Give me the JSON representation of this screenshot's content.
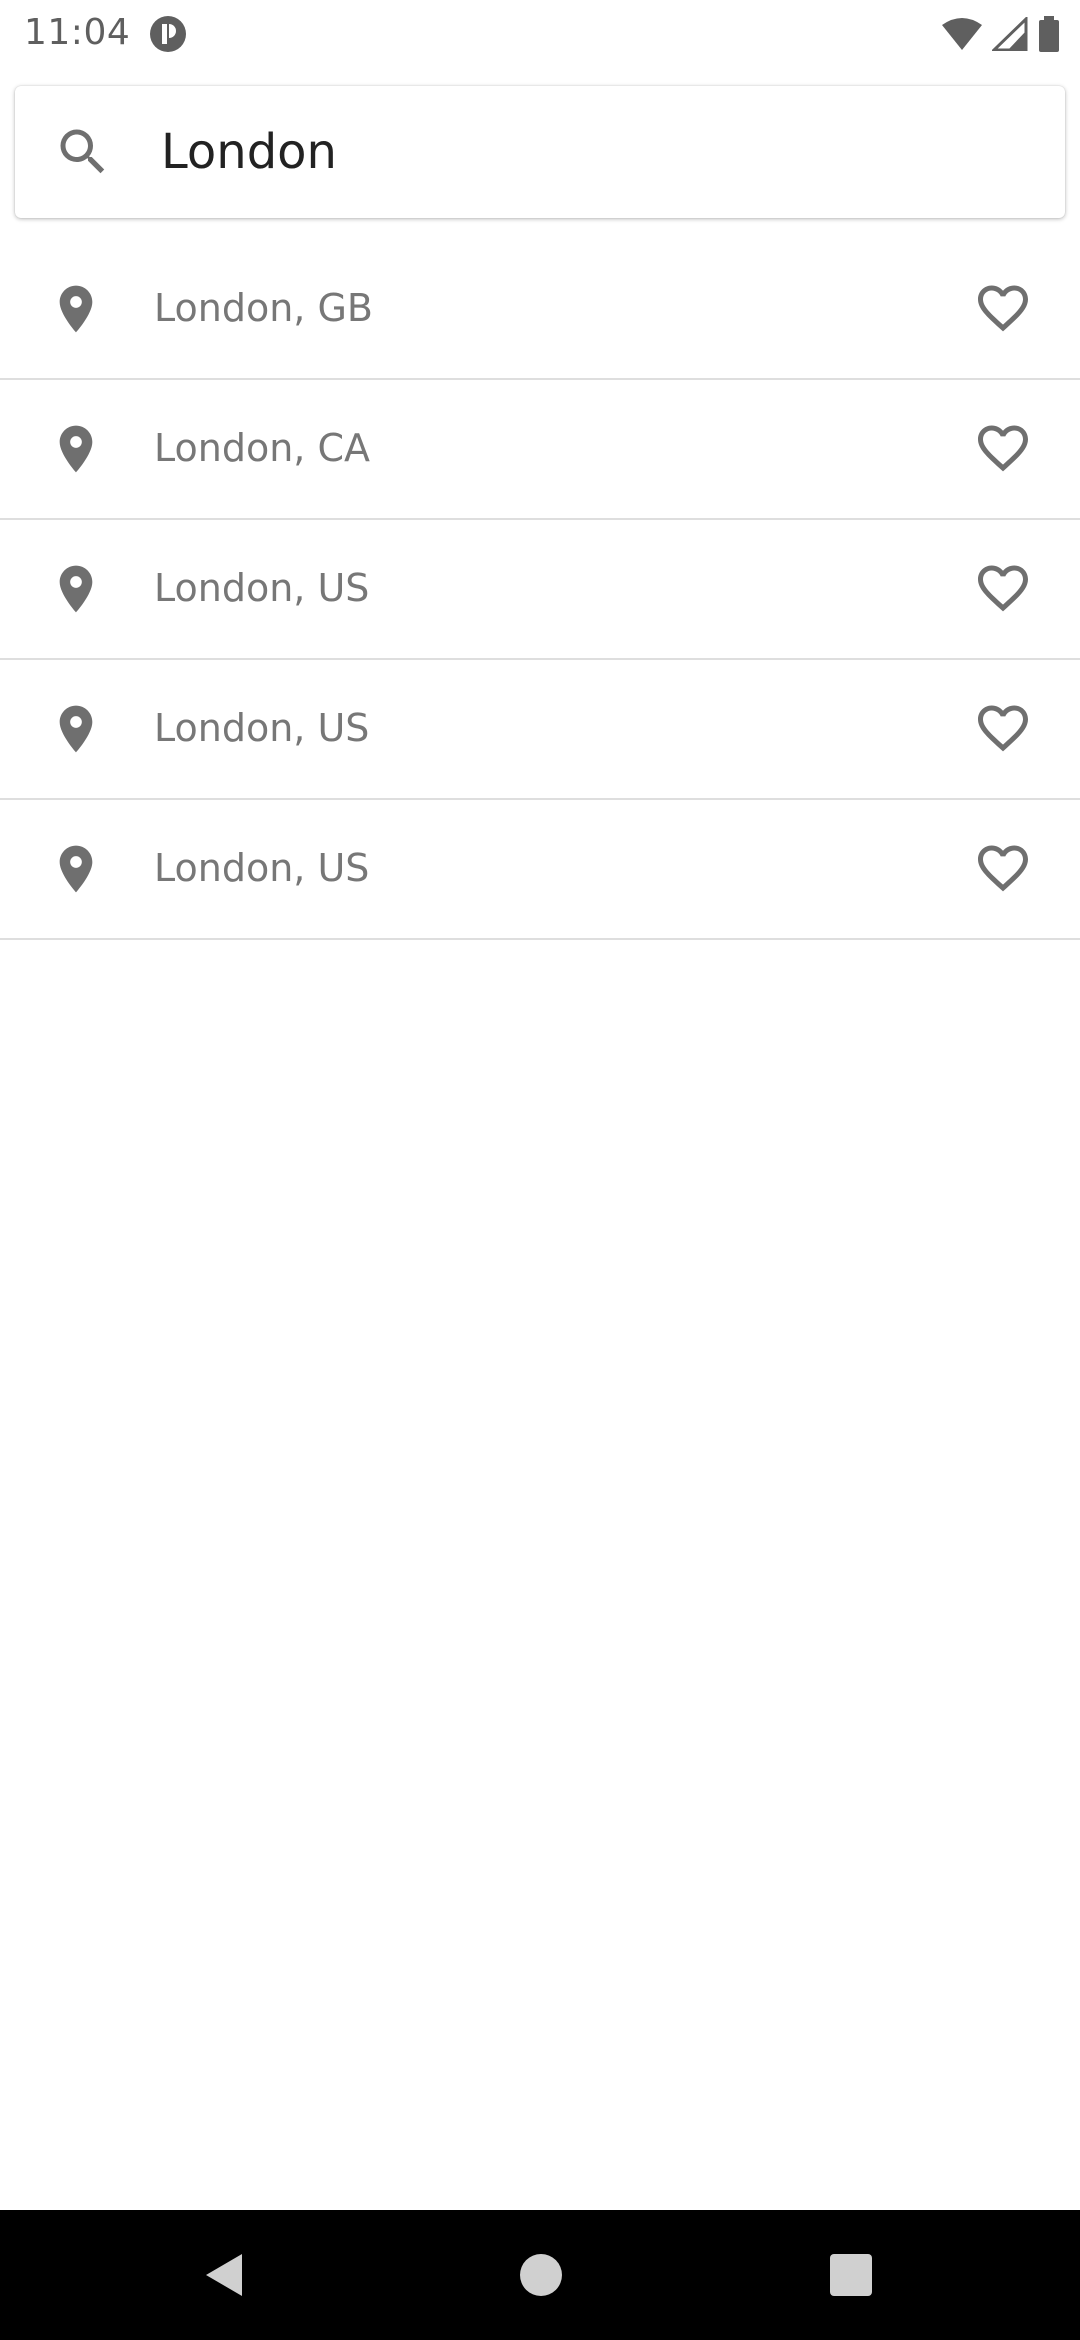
{
  "status_bar": {
    "time": "11:04",
    "app_icon": "app-notification-icon",
    "icons": [
      "wifi-icon",
      "signal-icon",
      "battery-icon"
    ]
  },
  "search": {
    "value": "London",
    "placeholder": "",
    "icon": "search-icon"
  },
  "results": [
    {
      "label": "London, GB",
      "icon": "location-pin-icon",
      "favorite_icon": "heart-outline-icon"
    },
    {
      "label": "London, CA",
      "icon": "location-pin-icon",
      "favorite_icon": "heart-outline-icon"
    },
    {
      "label": "London, US",
      "icon": "location-pin-icon",
      "favorite_icon": "heart-outline-icon"
    },
    {
      "label": "London, US",
      "icon": "location-pin-icon",
      "favorite_icon": "heart-outline-icon"
    },
    {
      "label": "London, US",
      "icon": "location-pin-icon",
      "favorite_icon": "heart-outline-icon"
    }
  ],
  "nav_bar": {
    "buttons": [
      "back-icon",
      "home-icon",
      "recents-icon"
    ]
  },
  "colors": {
    "icon_gray": "#6f6f6f",
    "label_gray": "#777777",
    "divider": "#dedede",
    "nav_bar_bg": "#000000"
  }
}
